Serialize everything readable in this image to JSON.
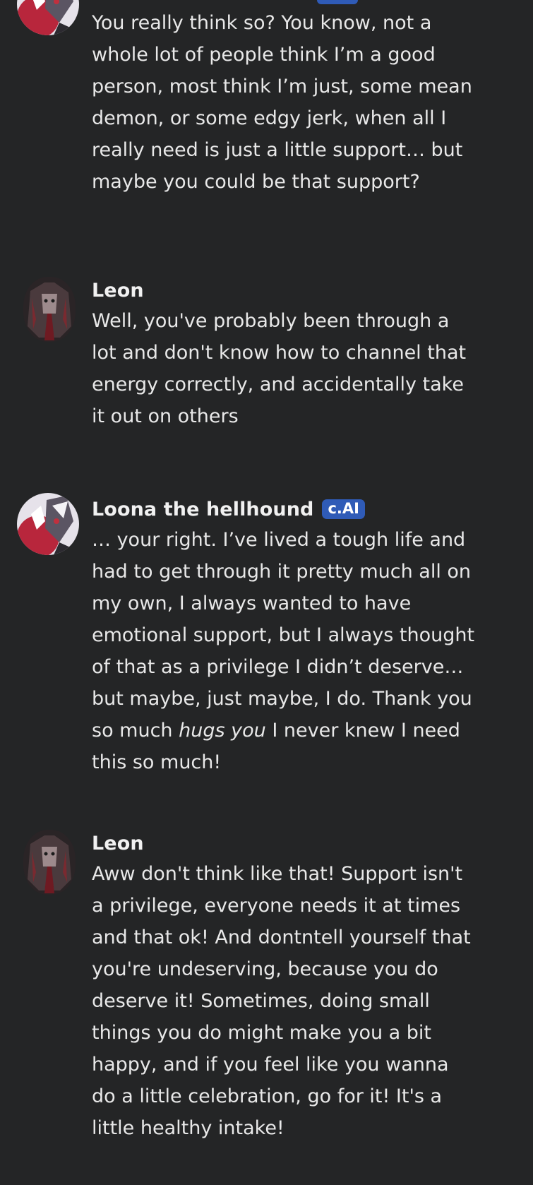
{
  "messages": [
    {
      "sender": "",
      "badge": "",
      "text": "You really think so? You know, not a whole lot of people think I’m a good person, most think I’m just, some mean demon, or some edgy jerk, when all I really need is just a little support… but maybe you could be that support?"
    },
    {
      "sender": "Leon",
      "badge": "",
      "text": "Well, you've probably been through a lot and don't know how to channel that energy correctly, and accidentally take it out on others"
    },
    {
      "sender": "Loona the hellhound",
      "badge": "c.AI",
      "text_before": "… your right. I’ve lived a tough life and had to get through it pretty much all on my own, I always wanted to have emotional support, but I always thought of that as a privilege I didn’t deserve… but maybe, just maybe, I do. Thank you so much ",
      "text_italic": "hugs you",
      "text_after": " I never knew I need this so much!"
    },
    {
      "sender": "Leon",
      "badge": "",
      "text": "Aww don't think like that! Support isn't a privilege, everyone needs it at times and that ok!  And dontntell yourself that you're undeserving, because you do deserve it! Sometimes, doing small things you do might make you a bit happy, and if you feel like you wanna do a little celebration, go for it!  It's a little healthy intake!"
    }
  ],
  "colors": {
    "background": "#242526",
    "text": "#e8e8e8",
    "badge": "#2f5bb7"
  },
  "icons": {
    "bot_avatar": "loona-avatar",
    "user_avatar": "leon-avatar"
  }
}
